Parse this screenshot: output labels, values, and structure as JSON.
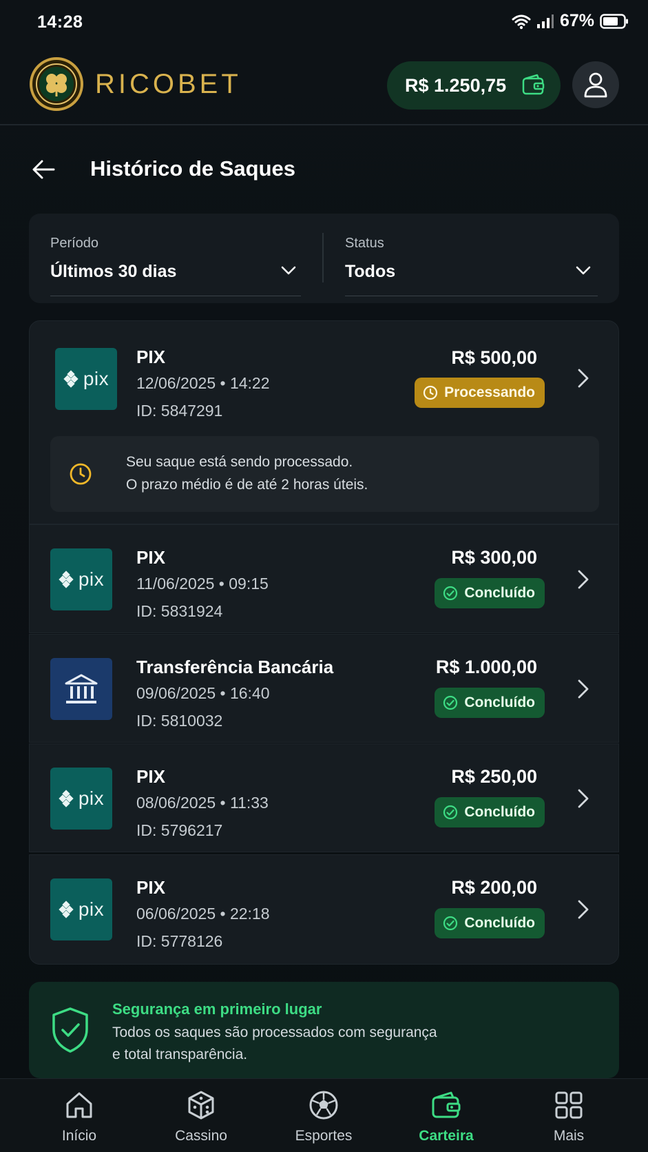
{
  "status_bar": {
    "time": "14:28",
    "battery": "67%"
  },
  "header": {
    "brand": "RICOBET",
    "balance": "R$ 1.250,75"
  },
  "page": {
    "title": "Histórico de Saques"
  },
  "filters": {
    "period": {
      "label": "Período",
      "value": "Últimos 30 dias"
    },
    "status": {
      "label": "Status",
      "value": "Todos"
    }
  },
  "withdrawals": [
    {
      "method": "PIX",
      "logo": "pix",
      "datetime": "12/06/2025 • 14:22",
      "id": "ID: 5847291",
      "amount": "R$ 500,00",
      "status": "Processando",
      "notice": [
        "Seu saque está sendo processado.",
        "O prazo médio é de até 2 horas úteis."
      ]
    },
    {
      "method": "PIX",
      "logo": "pix",
      "datetime": "11/06/2025 • 09:15",
      "id": "ID: 5831924",
      "amount": "R$ 300,00",
      "status": "Concluído"
    },
    {
      "method": "Transferência Bancária",
      "logo": "bank",
      "datetime": "09/06/2025 • 16:40",
      "id": "ID: 5810032",
      "amount": "R$ 1.000,00",
      "status": "Concluído"
    },
    {
      "method": "PIX",
      "logo": "pix",
      "datetime": "08/06/2025 • 11:33",
      "id": "ID: 5796217",
      "amount": "R$ 250,00",
      "status": "Concluído"
    },
    {
      "method": "PIX",
      "logo": "pix",
      "datetime": "06/06/2025 • 22:18",
      "id": "ID: 5778126",
      "amount": "R$ 200,00",
      "status": "Concluído"
    }
  ],
  "pix_word": "pix",
  "security": {
    "title": "Segurança em primeiro lugar",
    "lines": [
      "Todos os saques são processados com segurança",
      "e total transparência."
    ]
  },
  "nav": [
    {
      "label": "Início",
      "icon": "home-icon"
    },
    {
      "label": "Cassino",
      "icon": "dice-icon"
    },
    {
      "label": "Esportes",
      "icon": "soccer-ball-icon"
    },
    {
      "label": "Carteira",
      "icon": "wallet-icon",
      "active": true
    },
    {
      "label": "Mais",
      "icon": "grid-icon"
    }
  ],
  "colors": {
    "accent_green": "#3ddc84",
    "gold": "#d9b24e",
    "processing": "#b88a16",
    "done": "#145a32"
  }
}
